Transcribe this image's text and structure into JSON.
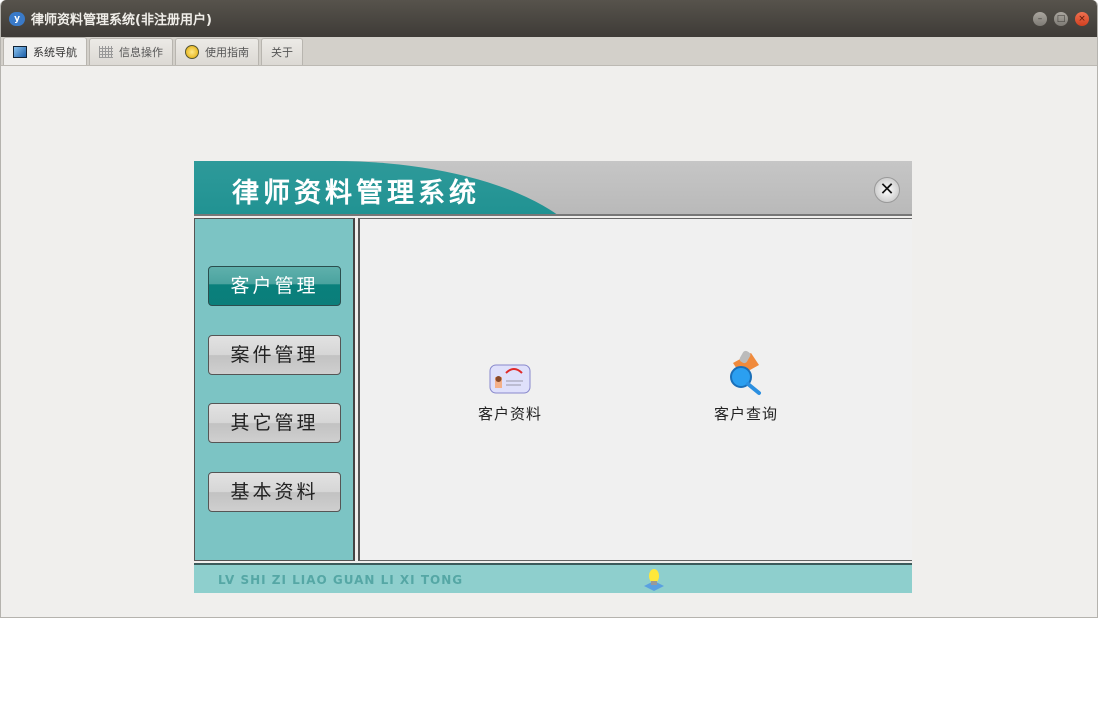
{
  "window": {
    "title": "律师资料管理系统(非注册用户)",
    "app_icon": "y"
  },
  "tabs": [
    {
      "label": "系统导航",
      "icon": "monitor-icon"
    },
    {
      "label": "信息操作",
      "icon": "grid-icon"
    },
    {
      "label": "使用指南",
      "icon": "help-icon"
    },
    {
      "label": "关于"
    }
  ],
  "panel": {
    "title": "律师资料管理系统",
    "close": "✕",
    "nav": [
      {
        "label": "客户管理",
        "active": true
      },
      {
        "label": "案件管理"
      },
      {
        "label": "其它管理"
      },
      {
        "label": "基本资料"
      }
    ],
    "items": [
      {
        "label": "客户资料",
        "icon": "contact-card-icon"
      },
      {
        "label": "客户查询",
        "icon": "search-magnifier-icon"
      }
    ],
    "footer": "LV SHI ZI LIAO GUAN LI XI TONG"
  },
  "colors": {
    "teal": "#138a8a",
    "side": "#7cc4c4",
    "footer": "#8ecfcd"
  }
}
